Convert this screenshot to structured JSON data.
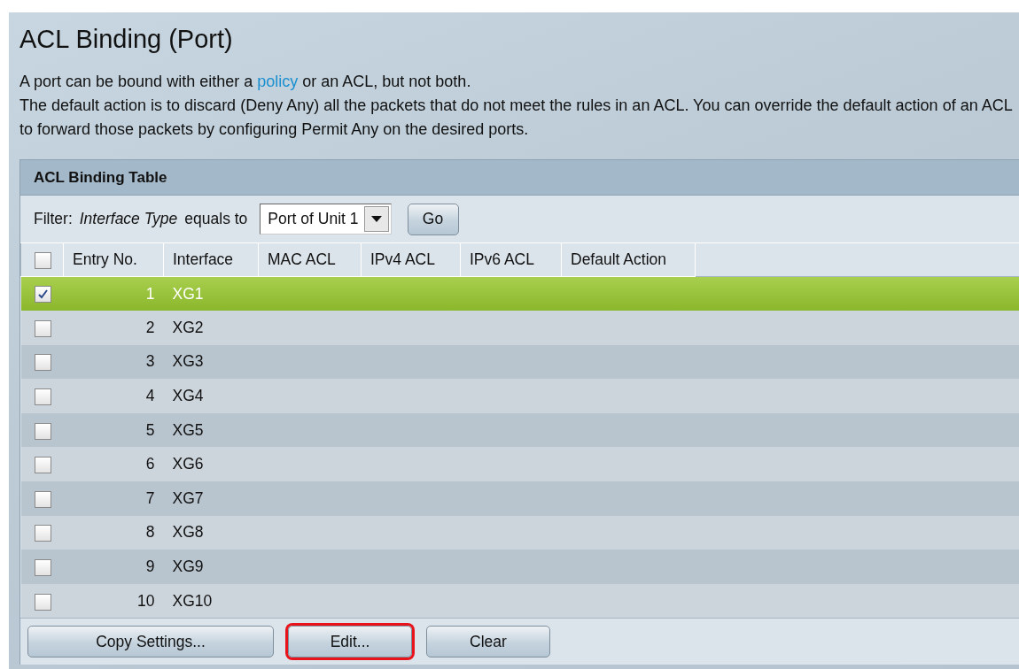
{
  "page": {
    "title": "ACL Binding (Port)",
    "intro": {
      "before": "A port can be bound with either a",
      "link": "policy",
      "after": "or an ACL, but not both."
    },
    "description": "The default action is to discard (Deny Any) all the packets that do not meet the rules in an ACL. You can override the default action of an ACL to forward those packets by configuring Permit Any on the desired ports."
  },
  "table": {
    "title": "ACL Binding Table",
    "filter": {
      "label": "Filter:",
      "field": "Interface Type",
      "operator": "equals to",
      "value": "Port of Unit 1",
      "button": "Go"
    },
    "select_all_checked": false,
    "columns": [
      "Entry No.",
      "Interface",
      "MAC ACL",
      "IPv4 ACL",
      "IPv6 ACL",
      "Default Action"
    ],
    "rows": [
      {
        "entry": "1",
        "interface": "XG1",
        "selected": true
      },
      {
        "entry": "2",
        "interface": "XG2",
        "selected": false
      },
      {
        "entry": "3",
        "interface": "XG3",
        "selected": false
      },
      {
        "entry": "4",
        "interface": "XG4",
        "selected": false
      },
      {
        "entry": "5",
        "interface": "XG5",
        "selected": false
      },
      {
        "entry": "6",
        "interface": "XG6",
        "selected": false
      },
      {
        "entry": "7",
        "interface": "XG7",
        "selected": false
      },
      {
        "entry": "8",
        "interface": "XG8",
        "selected": false
      },
      {
        "entry": "9",
        "interface": "XG9",
        "selected": false
      },
      {
        "entry": "10",
        "interface": "XG10",
        "selected": false
      }
    ],
    "buttons": [
      {
        "label": "Copy Settings...",
        "highlighted": false
      },
      {
        "label": "Edit...",
        "highlighted": true
      },
      {
        "label": "Clear",
        "highlighted": false
      }
    ]
  }
}
